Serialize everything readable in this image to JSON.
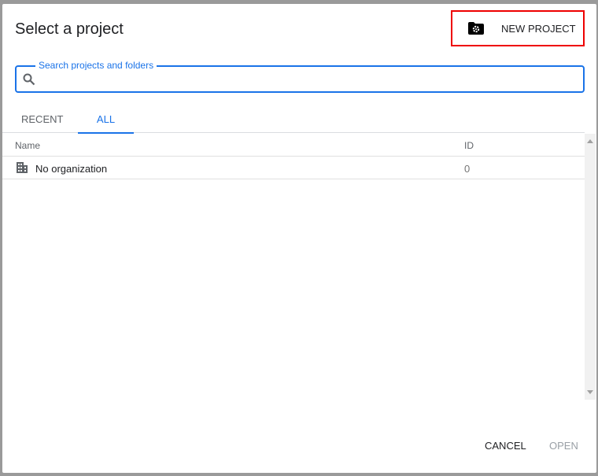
{
  "dialog": {
    "title": "Select a project",
    "new_project_label": "NEW PROJECT",
    "search": {
      "label": "Search projects and folders",
      "value": "",
      "placeholder": ""
    },
    "tabs": [
      {
        "label": "RECENT",
        "active": false
      },
      {
        "label": "ALL",
        "active": true
      }
    ],
    "table": {
      "headers": {
        "name": "Name",
        "id": "ID"
      },
      "rows": [
        {
          "name": "No organization",
          "id": "0",
          "icon": "building-icon"
        }
      ]
    },
    "buttons": {
      "cancel": "CANCEL",
      "open": "OPEN"
    },
    "colors": {
      "accent": "#1a73e8",
      "highlight": "#ee0000"
    }
  }
}
